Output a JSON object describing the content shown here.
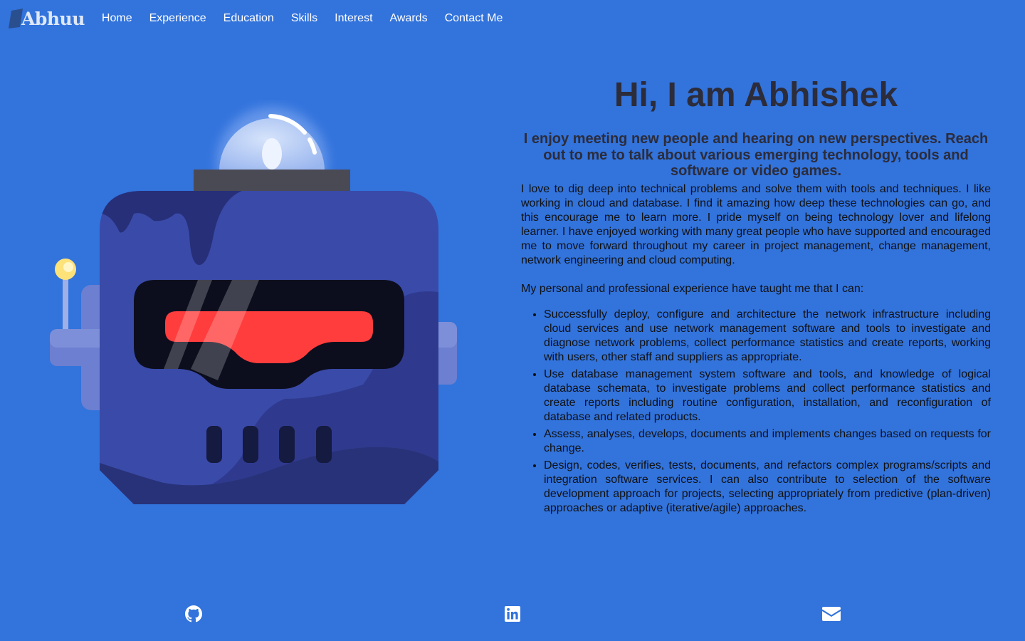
{
  "nav": {
    "brand": "Abhuu",
    "items": [
      "Home",
      "Experience",
      "Education",
      "Skills",
      "Interest",
      "Awards",
      "Contact Me"
    ]
  },
  "hero": {
    "title": "Hi, I am Abhishek",
    "subtitle": "I enjoy meeting new people and hearing on new perspectives. Reach out to me to talk about various emerging technology, tools and software or video games.",
    "paragraph1": "I love to dig deep into technical problems and solve them with tools and techniques. I like working in cloud and database. I find it amazing how deep these technologies can go, and this encourage me to learn more. I pride myself on being technology lover and lifelong learner. I have enjoyed working with many great people who have supported and encouraged me to move forward throughout my career in project management, change management, network engineering and cloud computing.",
    "paragraph2": "My personal and professional experience have taught me that I can:",
    "bullets": [
      "Successfully deploy, configure and architecture the network infrastructure including cloud services and use network management software and tools to investigate and diagnose network problems, collect performance statistics and create reports, working with users, other staff and suppliers as appropriate.",
      "Use database management system software and tools, and knowledge of logical database schemata, to investigate problems and collect performance statistics and create reports including routine configuration, installation, and reconfiguration of database and related products.",
      "Assess, analyses, develops, documents and implements changes based on requests for change.",
      "Design, codes, verifies, tests, documents, and refactors complex programs/scripts and integration software services. I can also contribute to selection of the software development approach for projects, selecting appropriately from predictive (plan-driven) approaches or adaptive (iterative/agile) approaches."
    ]
  },
  "footer": {
    "icons": [
      "github-icon",
      "linkedin-icon",
      "envelope-icon"
    ]
  },
  "colors": {
    "background": "#3273dc",
    "robot_body": "#3a4aa8",
    "visor": "#0c0e1e",
    "visor_light": "#ff3d3d"
  }
}
